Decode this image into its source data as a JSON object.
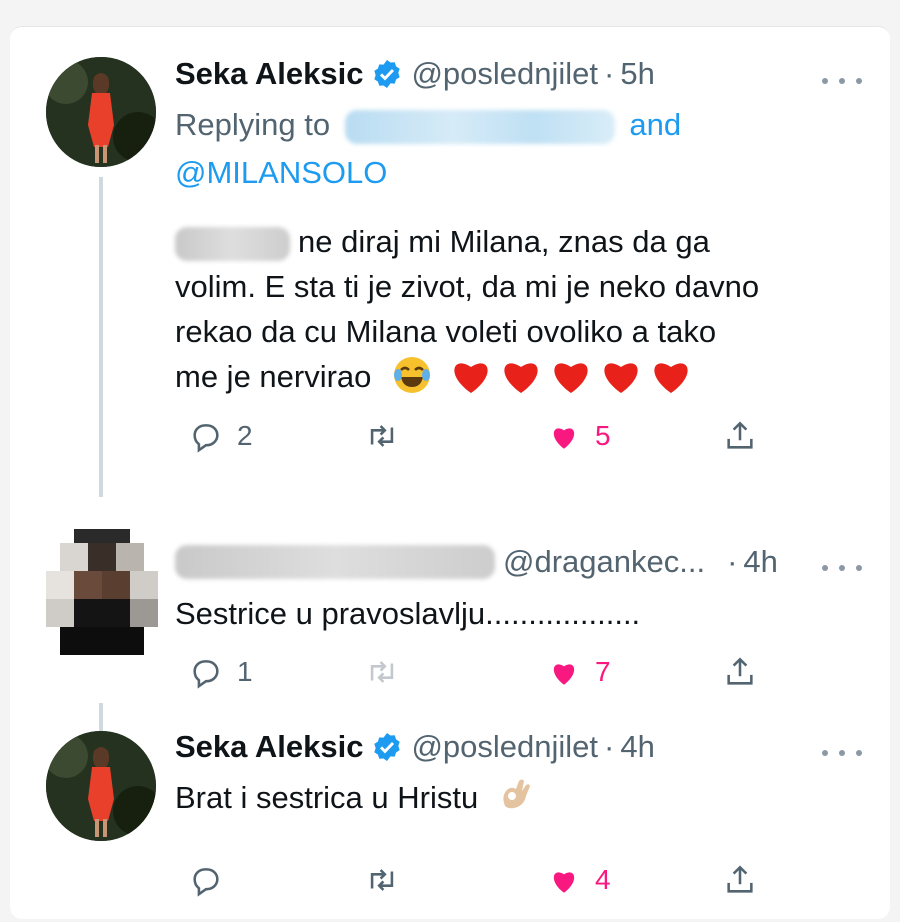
{
  "tweets": [
    {
      "author": "Seka Aleksic",
      "handle": "@poslednjilet",
      "dot": "·",
      "time": "5h",
      "replying_prefix": "Replying to",
      "replying_and": "and",
      "replying_mention": "@MILANSOLO",
      "text_line1": "ne diraj mi Milana, znas da ga",
      "text_line2": "volim. E sta ti je zivot, da mi je neko davno",
      "text_line3": "rekao da cu Milana voleti ovoliko a tako",
      "text_line4": "me je nervirao",
      "reply_count": "2",
      "retweet_count": "",
      "like_count": "5"
    },
    {
      "handle": "@dragankec...",
      "dot": "·",
      "time": "4h",
      "text": "Sestrice u pravoslavlju..................",
      "reply_count": "1",
      "retweet_count": "",
      "like_count": "7"
    },
    {
      "author": "Seka Aleksic",
      "handle": "@poslednjilet",
      "dot": "·",
      "time": "4h",
      "text": "Brat i sestrica u Hristu",
      "reply_count": "",
      "retweet_count": "",
      "like_count": "4"
    }
  ],
  "colors": {
    "accent": "#1d9bf0",
    "like": "#f91880",
    "secondary_text": "#536471"
  },
  "icons": [
    "verified-badge-icon",
    "more-icon",
    "reply-icon",
    "retweet-icon",
    "like-icon",
    "share-icon",
    "red-heart-emoji",
    "laughing-emoji",
    "ok-hand-emoji"
  ]
}
